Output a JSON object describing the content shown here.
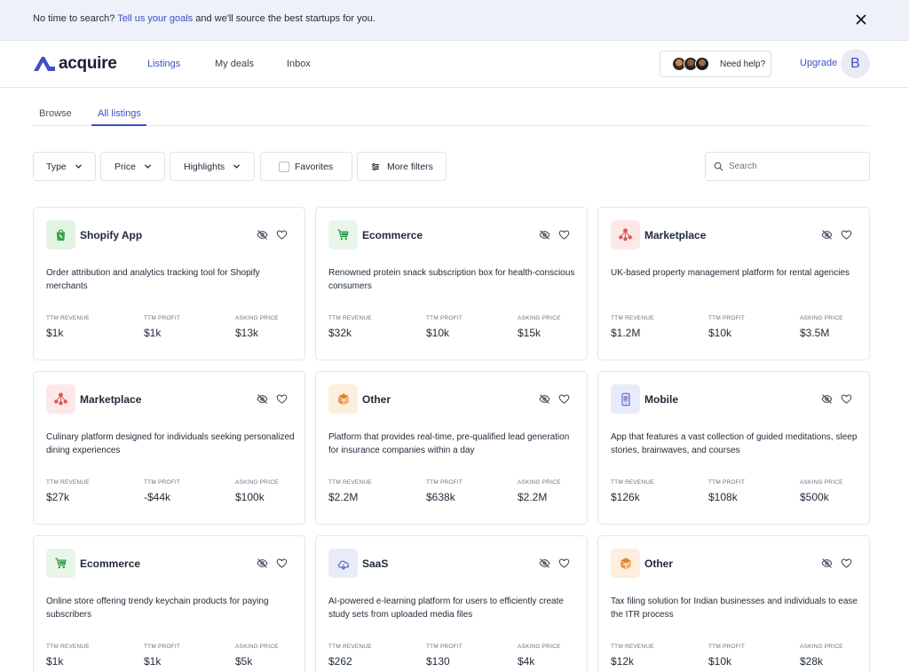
{
  "banner": {
    "pre": "No time to search? ",
    "link": "Tell us your goals",
    "post": " and we'll source the best startups for you."
  },
  "nav": {
    "brand": "acquire",
    "items": [
      "Listings",
      "My deals",
      "Inbox"
    ],
    "help": "Need help?",
    "upgrade": "Upgrade",
    "avatar_initial": "B"
  },
  "tabs": [
    "Browse",
    "All listings"
  ],
  "filters": {
    "type": "Type",
    "price": "Price",
    "highlights": "Highlights",
    "favorites": "Favorites",
    "more": "More filters",
    "search_placeholder": "Search"
  },
  "metric_labels": {
    "revenue": "TTM REVENUE",
    "profit": "TTM PROFIT",
    "asking": "ASKING PRICE"
  },
  "listings": [
    {
      "category": "Shopify App",
      "icon": "shopify-bag-icon",
      "description": "Order attribution and analytics tracking tool for Shopify merchants",
      "revenue": "$1k",
      "profit": "$1k",
      "asking": "$13k"
    },
    {
      "category": "Ecommerce",
      "icon": "shopping-cart-icon",
      "description": "Renowned protein snack subscription box for health-conscious consumers",
      "revenue": "$32k",
      "profit": "$10k",
      "asking": "$15k"
    },
    {
      "category": "Marketplace",
      "icon": "marketplace-network-icon",
      "description": "UK-based property management platform for rental agencies",
      "revenue": "$1.2M",
      "profit": "$10k",
      "asking": "$3.5M"
    },
    {
      "category": "Marketplace",
      "icon": "marketplace-network-icon",
      "description": "Culinary platform designed for individuals seeking personalized dining experiences",
      "revenue": "$27k",
      "profit": "-$44k",
      "asking": "$100k"
    },
    {
      "category": "Other",
      "icon": "other-box-icon",
      "description": "Platform that provides real-time, pre-qualified lead generation for insurance companies within a day",
      "revenue": "$2.2M",
      "profit": "$638k",
      "asking": "$2.2M"
    },
    {
      "category": "Mobile",
      "icon": "mobile-phone-icon",
      "description": "App that features a vast collection of guided meditations, sleep stories, brainwaves, and courses",
      "revenue": "$126k",
      "profit": "$108k",
      "asking": "$500k"
    },
    {
      "category": "Ecommerce",
      "icon": "shopping-cart-icon",
      "description": "Online store offering trendy keychain products for paying subscribers",
      "revenue": "$1k",
      "profit": "$1k",
      "asking": "$5k"
    },
    {
      "category": "SaaS",
      "icon": "cloud-icon",
      "description": "AI-powered e-learning platform for users to efficiently create study sets from uploaded media files",
      "revenue": "$262",
      "profit": "$130",
      "asking": "$4k"
    },
    {
      "category": "Other",
      "icon": "other-box-icon",
      "description": "Tax filing solution for Indian businesses and individuals to ease the ITR process",
      "revenue": "$12k",
      "profit": "$10k",
      "asking": "$28k"
    }
  ],
  "colors": {
    "accent": "#3d50c5",
    "shopify_bg": "#e4f4e4",
    "shopify_fg": "#3aa346",
    "ecommerce_bg": "#e8f6ea",
    "ecommerce_fg": "#2e9a44",
    "marketplace_bg": "#fde8e8",
    "marketplace_fg": "#e05757",
    "other_bg": "#fdeedd",
    "other_fg": "#e0802a",
    "mobile_bg": "#e8ebfa",
    "mobile_fg": "#5566cc",
    "saas_bg": "#e9ecf8",
    "saas_fg": "#5a6acb"
  }
}
